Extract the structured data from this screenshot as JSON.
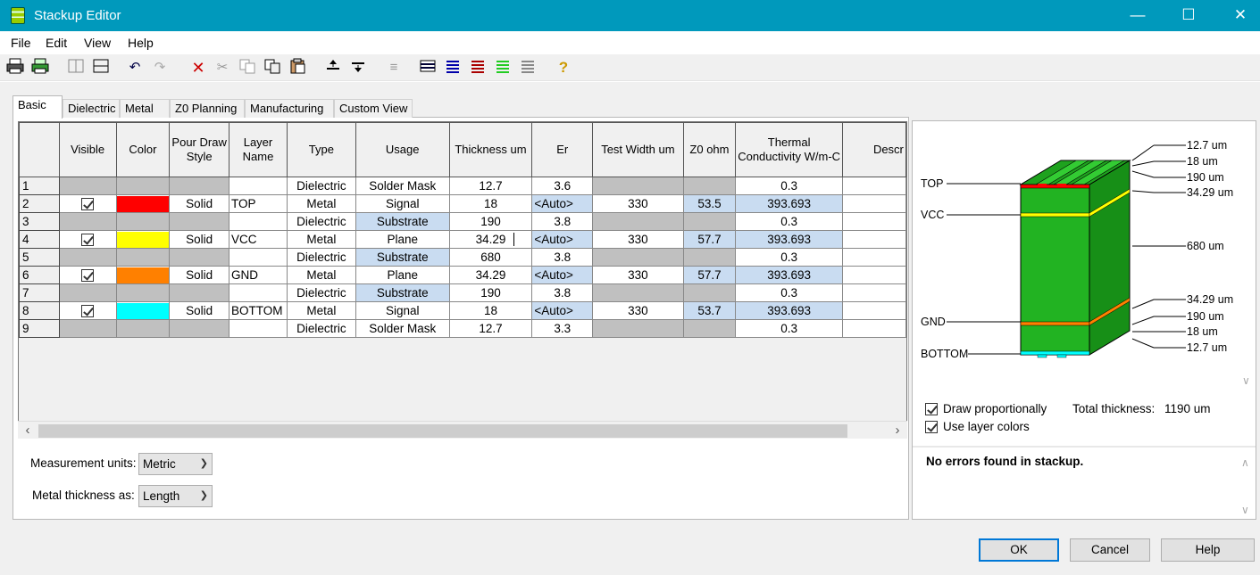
{
  "window": {
    "title": "Stackup Editor",
    "min_icon": "minimize-icon",
    "max_icon": "maximize-icon",
    "close_icon": "close-icon"
  },
  "menu": [
    "File",
    "Edit",
    "View",
    "Help"
  ],
  "tabs": [
    "Basic",
    "Dielectric",
    "Metal",
    "Z0 Planning",
    "Manufacturing",
    "Custom View"
  ],
  "columns": [
    "",
    "Visible",
    "Color",
    "Pour Draw Style",
    "Layer Name",
    "Type",
    "Usage",
    "Thickness um",
    "Er",
    "Test Width um",
    "Z0 ohm",
    "Thermal Conductivity W/m-C",
    "Descr"
  ],
  "rows": [
    {
      "n": "1",
      "visible": false,
      "color": "",
      "style": "",
      "name": "",
      "type": "Dielectric",
      "usage": "Solder Mask",
      "thickness": "12.7",
      "er": "3.6",
      "tw": "",
      "z0": "",
      "tc": "0.3"
    },
    {
      "n": "2",
      "visible": true,
      "color": "#ff0000",
      "style": "Solid",
      "name": "TOP",
      "type": "Metal",
      "usage": "Signal",
      "thickness": "18",
      "er": "<Auto>",
      "tw": "330",
      "z0": "53.5",
      "tc": "393.693"
    },
    {
      "n": "3",
      "visible": false,
      "color": "",
      "style": "",
      "name": "",
      "type": "Dielectric",
      "usage": "Substrate",
      "thickness": "190",
      "er": "3.8",
      "tw": "",
      "z0": "",
      "tc": "0.3"
    },
    {
      "n": "4",
      "visible": true,
      "color": "#ffff00",
      "style": "Solid",
      "name": "VCC",
      "type": "Metal",
      "usage": "Plane",
      "thickness": "34.29",
      "er": "<Auto>",
      "tw": "330",
      "z0": "57.7",
      "tc": "393.693"
    },
    {
      "n": "5",
      "visible": false,
      "color": "",
      "style": "",
      "name": "",
      "type": "Dielectric",
      "usage": "Substrate",
      "thickness": "680",
      "er": "3.8",
      "tw": "",
      "z0": "",
      "tc": "0.3"
    },
    {
      "n": "6",
      "visible": true,
      "color": "#ff8000",
      "style": "Solid",
      "name": "GND",
      "type": "Metal",
      "usage": "Plane",
      "thickness": "34.29",
      "er": "<Auto>",
      "tw": "330",
      "z0": "57.7",
      "tc": "393.693"
    },
    {
      "n": "7",
      "visible": false,
      "color": "",
      "style": "",
      "name": "",
      "type": "Dielectric",
      "usage": "Substrate",
      "thickness": "190",
      "er": "3.8",
      "tw": "",
      "z0": "",
      "tc": "0.3"
    },
    {
      "n": "8",
      "visible": true,
      "color": "#00ffff",
      "style": "Solid",
      "name": "BOTTOM",
      "type": "Metal",
      "usage": "Signal",
      "thickness": "18",
      "er": "<Auto>",
      "tw": "330",
      "z0": "53.7",
      "tc": "393.693"
    },
    {
      "n": "9",
      "visible": false,
      "color": "",
      "style": "",
      "name": "",
      "type": "Dielectric",
      "usage": "Solder Mask",
      "thickness": "12.7",
      "er": "3.3",
      "tw": "",
      "z0": "",
      "tc": "0.3"
    }
  ],
  "units": {
    "label": "Measurement units:",
    "value": "Metric"
  },
  "metal": {
    "label": "Metal thickness as:",
    "value": "Length"
  },
  "diagram": {
    "layers": [
      {
        "name": "TOP",
        "color": "#ff0000"
      },
      {
        "name": "VCC",
        "color": "#ffff00"
      },
      {
        "name": "GND",
        "color": "#ff8000"
      },
      {
        "name": "BOTTOM",
        "color": "#00ffff"
      }
    ],
    "dims": [
      "12.7 um",
      "18 um",
      "190 um",
      "34.29 um",
      "680 um",
      "34.29 um",
      "190 um",
      "18 um",
      "12.7 um"
    ],
    "substrate_color": "#22b322"
  },
  "options": {
    "draw_prop": "Draw proportionally",
    "use_colors": "Use layer colors",
    "total_label": "Total thickness:",
    "total_value": "1190 um"
  },
  "status": "No errors found in stackup.",
  "buttons": {
    "ok": "OK",
    "cancel": "Cancel",
    "help": "Help"
  }
}
